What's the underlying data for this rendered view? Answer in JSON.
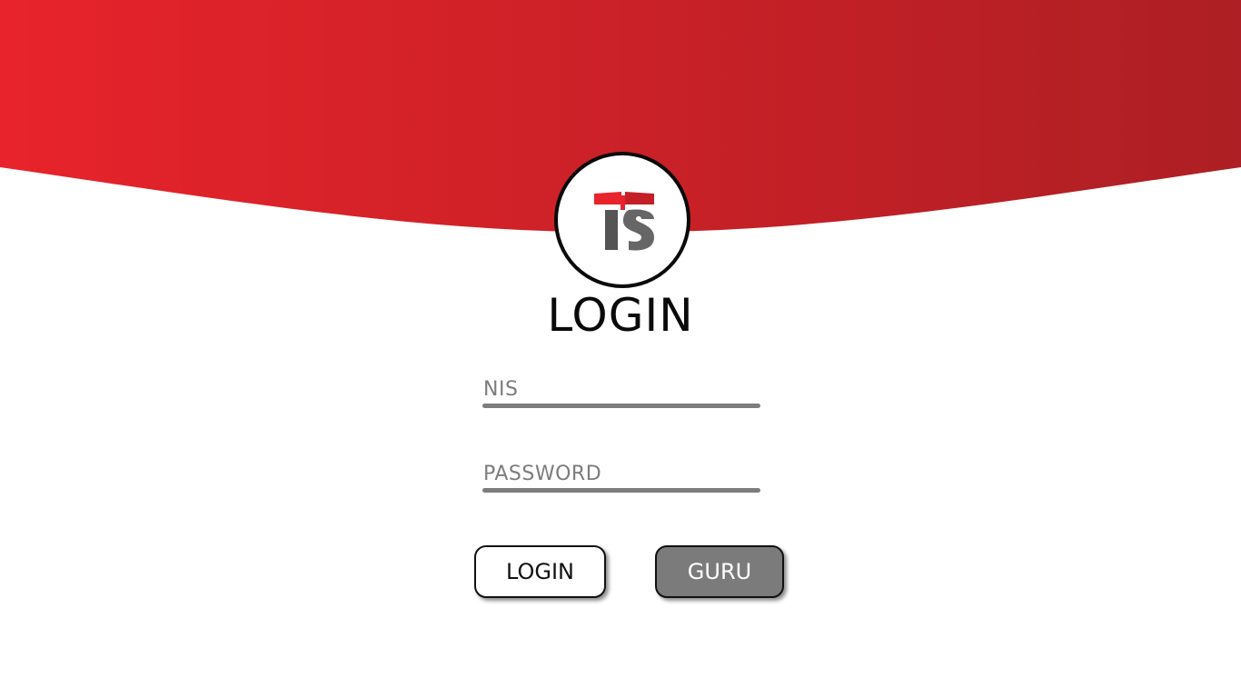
{
  "header": {
    "gradient_start": "#e8232b",
    "gradient_end": "#ad1f24"
  },
  "logo": {
    "icon": "ts-book-logo-icon",
    "book_color": "#e8232b",
    "letters_color": "#555555"
  },
  "title": "LOGIN",
  "form": {
    "nis_placeholder": "NIS",
    "password_placeholder": "PASSWORD"
  },
  "buttons": {
    "login_label": "LOGIN",
    "guru_label": "GURU"
  },
  "colors": {
    "accent": "#e8232b",
    "field_line": "#7d7d7d",
    "guru_button": "#7b7b7b"
  }
}
